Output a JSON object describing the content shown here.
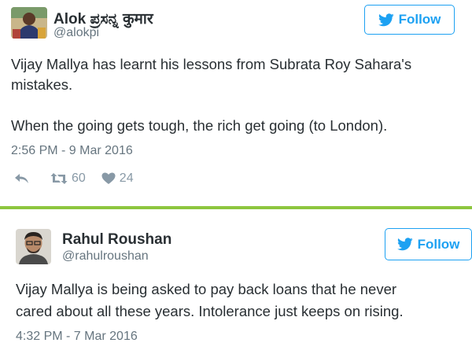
{
  "colors": {
    "twitter_blue": "#1da1f2",
    "divider": "#8dc63f",
    "text": "#292f33",
    "muted": "#66757f",
    "action_gray": "#8899a6"
  },
  "tweets": [
    {
      "name": "Alok ಪ್ರಸನ್ನ कुमार",
      "handle": "@alokpi",
      "avatar_icon": "user-avatar",
      "follow_label": "Follow",
      "follow_icon": "twitter-bird-icon",
      "paragraphs": [
        "Vijay Mallya has learnt his lessons from Subrata Roy Sahara's",
        "mistakes.",
        "When the going gets tough, the rich get going (to London)."
      ],
      "timestamp": "2:56 PM - 9 Mar 2016",
      "retweets": "60",
      "likes": "24"
    },
    {
      "name": "Rahul Roushan",
      "handle": "@rahulroushan",
      "avatar_icon": "user-avatar",
      "follow_label": "Follow",
      "follow_icon": "twitter-bird-icon",
      "paragraphs": [
        "Vijay Mallya is being asked to pay back loans that he never",
        "cared about all these years. Intolerance just keeps on rising."
      ],
      "timestamp": "4:32 PM - 7 Mar 2016"
    }
  ]
}
